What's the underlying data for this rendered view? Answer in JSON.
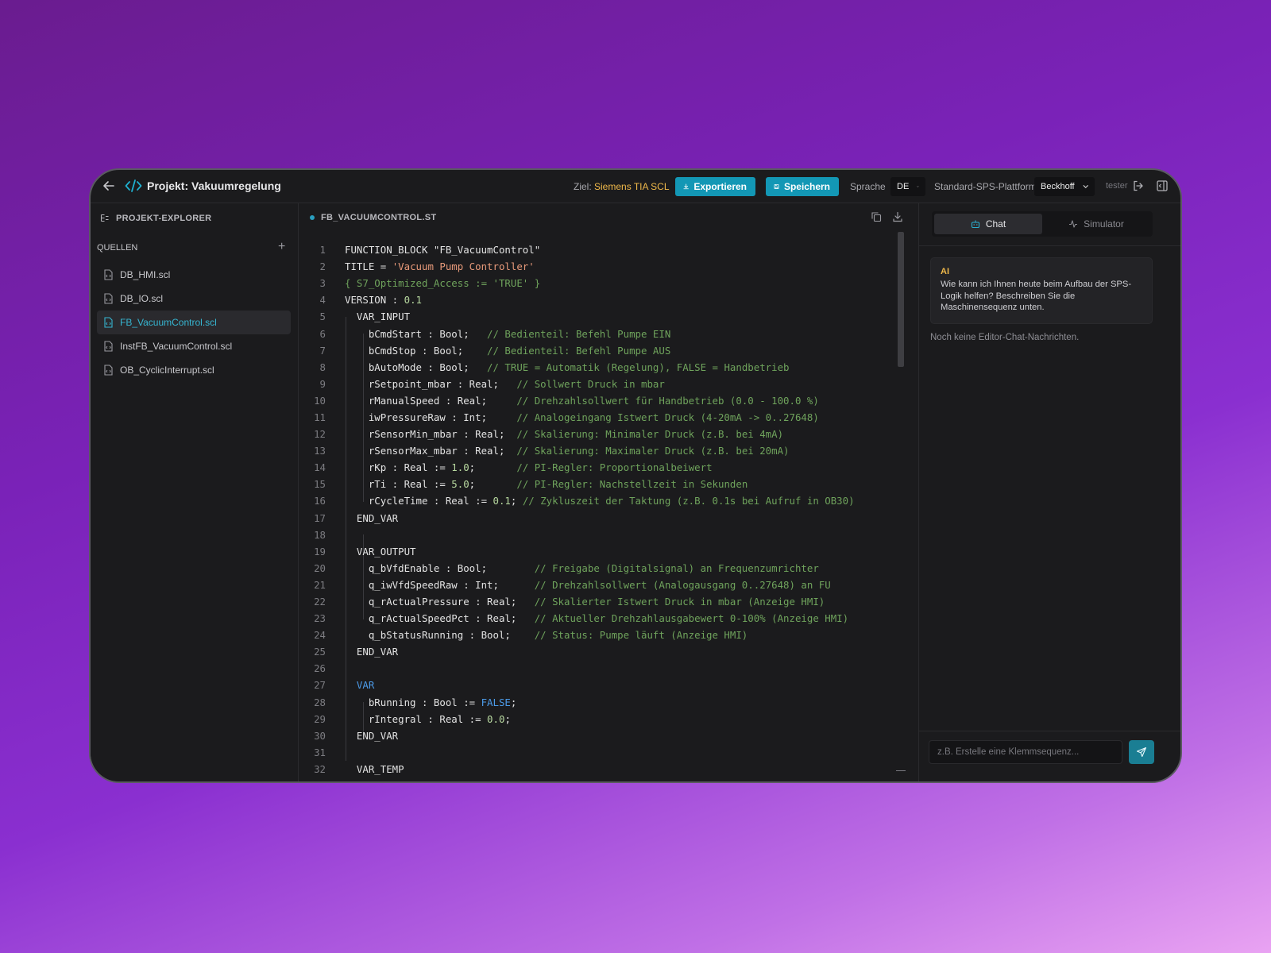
{
  "header": {
    "project_title": "Projekt: Vakuumregelung",
    "target_label": "Ziel:",
    "target_value": "Siemens TIA SCL",
    "export_label": "Exportieren",
    "save_label": "Speichern",
    "language_label": "Sprache",
    "language_value": "DE",
    "platform_label": "Standard-SPS-Plattform",
    "platform_value": "Beckhoff",
    "user": "tester"
  },
  "sidebar": {
    "title": "PROJEKT-EXPLORER",
    "section": "QUELLEN",
    "files": [
      "DB_HMI.scl",
      "DB_IO.scl",
      "FB_VacuumControl.scl",
      "InstFB_VacuumControl.scl",
      "OB_CyclicInterrupt.scl"
    ],
    "active_file": "FB_VacuumControl.scl"
  },
  "editor": {
    "tab": "FB_VACUUMCONTROL.ST",
    "lines": [
      {
        "n": "1",
        "code": "FUNCTION_BLOCK \"FB_VacuumControl\"",
        "comment": ""
      },
      {
        "n": "2",
        "code": "TITLE = 'Vacuum Pump Controller'",
        "comment": ""
      },
      {
        "n": "3",
        "code": "{ S7_Optimized_Access := 'TRUE' }",
        "comment": ""
      },
      {
        "n": "4",
        "code": "VERSION : 0.1",
        "comment": ""
      },
      {
        "n": "5",
        "code": "  VAR_INPUT",
        "comment": ""
      },
      {
        "n": "6",
        "code": "    bCmdStart : Bool;   ",
        "comment": "// Bedienteil: Befehl Pumpe EIN"
      },
      {
        "n": "7",
        "code": "    bCmdStop : Bool;    ",
        "comment": "// Bedienteil: Befehl Pumpe AUS"
      },
      {
        "n": "8",
        "code": "    bAutoMode : Bool;   ",
        "comment": "// TRUE = Automatik (Regelung), FALSE = Handbetrieb"
      },
      {
        "n": "9",
        "code": "    rSetpoint_mbar : Real;   ",
        "comment": "// Sollwert Druck in mbar"
      },
      {
        "n": "10",
        "code": "    rManualSpeed : Real;     ",
        "comment": "// Drehzahlsollwert für Handbetrieb (0.0 - 100.0 %)"
      },
      {
        "n": "11",
        "code": "    iwPressureRaw : Int;     ",
        "comment": "// Analogeingang Istwert Druck (4-20mA -> 0..27648)"
      },
      {
        "n": "12",
        "code": "    rSensorMin_mbar : Real;  ",
        "comment": "// Skalierung: Minimaler Druck (z.B. bei 4mA)"
      },
      {
        "n": "13",
        "code": "    rSensorMax_mbar : Real;  ",
        "comment": "// Skalierung: Maximaler Druck (z.B. bei 20mA)"
      },
      {
        "n": "14",
        "code": "    rKp : Real := 1.0;       ",
        "comment": "// PI-Regler: Proportionalbeiwert"
      },
      {
        "n": "15",
        "code": "    rTi : Real := 5.0;       ",
        "comment": "// PI-Regler: Nachstellzeit in Sekunden"
      },
      {
        "n": "16",
        "code": "    rCycleTime : Real := 0.1; ",
        "comment": "// Zykluszeit der Taktung (z.B. 0.1s bei Aufruf in OB30)"
      },
      {
        "n": "17",
        "code": "  END_VAR",
        "comment": ""
      },
      {
        "n": "18",
        "code": "",
        "comment": ""
      },
      {
        "n": "19",
        "code": "  VAR_OUTPUT",
        "comment": ""
      },
      {
        "n": "20",
        "code": "    q_bVfdEnable : Bool;        ",
        "comment": "// Freigabe (Digitalsignal) an Frequenzumrichter"
      },
      {
        "n": "21",
        "code": "    q_iwVfdSpeedRaw : Int;      ",
        "comment": "// Drehzahlsollwert (Analogausgang 0..27648) an FU"
      },
      {
        "n": "22",
        "code": "    q_rActualPressure : Real;   ",
        "comment": "// Skalierter Istwert Druck in mbar (Anzeige HMI)"
      },
      {
        "n": "23",
        "code": "    q_rActualSpeedPct : Real;   ",
        "comment": "// Aktueller Drehzahlausgabewert 0-100% (Anzeige HMI)"
      },
      {
        "n": "24",
        "code": "    q_bStatusRunning : Bool;    ",
        "comment": "// Status: Pumpe läuft (Anzeige HMI)"
      },
      {
        "n": "25",
        "code": "  END_VAR",
        "comment": ""
      },
      {
        "n": "26",
        "code": "",
        "comment": ""
      },
      {
        "n": "27",
        "code": "  VAR",
        "comment": ""
      },
      {
        "n": "28",
        "code": "    bRunning : Bool := FALSE;",
        "comment": ""
      },
      {
        "n": "29",
        "code": "    rIntegral : Real := 0.0;",
        "comment": ""
      },
      {
        "n": "30",
        "code": "  END_VAR",
        "comment": ""
      },
      {
        "n": "31",
        "code": "",
        "comment": ""
      },
      {
        "n": "32",
        "code": "  VAR_TEMP",
        "comment": ""
      }
    ]
  },
  "panel": {
    "tab_chat": "Chat",
    "tab_simulator": "Simulator",
    "ai_label": "AI",
    "ai_message": "Wie kann ich Ihnen heute beim Aufbau der SPS-Logik helfen? Beschreiben Sie die Maschinensequenz unten.",
    "empty_state": "Noch keine Editor-Chat-Nachrichten.",
    "input_placeholder": "z.B. Erstelle eine Klemmsequenz..."
  }
}
